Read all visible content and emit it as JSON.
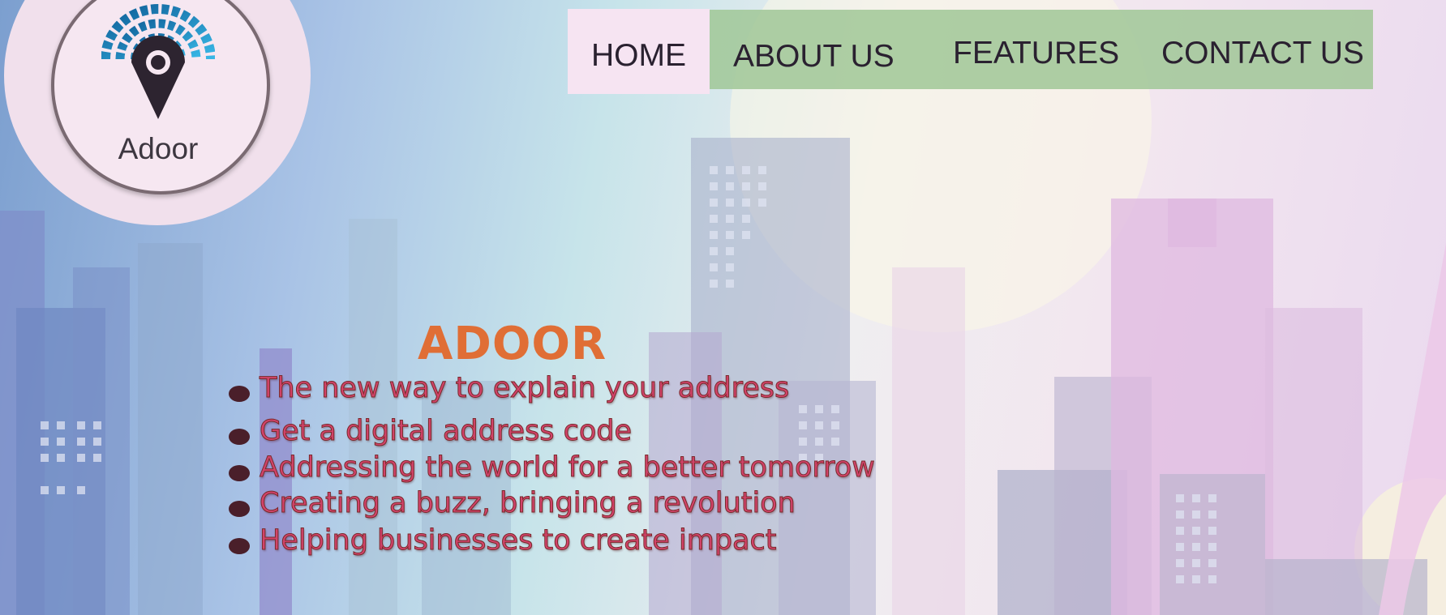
{
  "brand": {
    "logo_text": "Adoor",
    "logo_icon": "map-pin-signal-icon"
  },
  "nav": {
    "items": [
      {
        "label": "HOME",
        "active": true
      },
      {
        "label": "ABOUT US",
        "active": false
      },
      {
        "label": "FEATURES",
        "active": false
      },
      {
        "label": "CONTACT US",
        "active": false
      }
    ]
  },
  "hero": {
    "title": "ADOOR",
    "taglines": [
      "The new way to explain your address",
      "Get a digital address code",
      "Addressing the world for a better tomorrow",
      "Creating a buzz, bringing a revolution",
      "Helping businesses to create impact"
    ]
  },
  "colors": {
    "accent_orange": "#e06e35",
    "tagline_pink": "#d2436a",
    "nav_green": "#a0c796",
    "nav_active_bg": "#f6e4f2",
    "logo_blue": "#1f8ec9"
  }
}
